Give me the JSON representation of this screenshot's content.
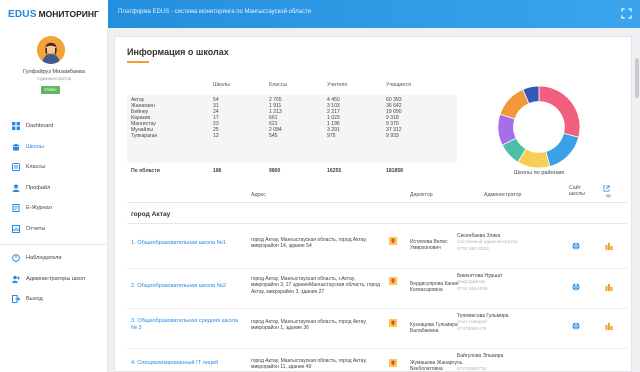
{
  "header": {
    "logo_edus": "EDUS",
    "logo_monitoring": "МОНИТОРИНГ",
    "title": "Платформа EDUS - система мониторинга по Мангыстауской области"
  },
  "user": {
    "name": "Гулфайруз Мизамбаева",
    "role": "Администратор",
    "status": "Online"
  },
  "nav": {
    "main": [
      {
        "label": "Dashboard",
        "icon": "grid-icon"
      },
      {
        "label": "Школы",
        "icon": "school-icon",
        "active": true
      },
      {
        "label": "Классы",
        "icon": "classes-icon"
      },
      {
        "label": "Профайл",
        "icon": "profile-icon"
      },
      {
        "label": "Е-Журнал",
        "icon": "journal-icon"
      },
      {
        "label": "Отчеты",
        "icon": "reports-icon"
      }
    ],
    "secondary": [
      {
        "label": "Наблюдатели",
        "icon": "observer-icon"
      },
      {
        "label": "Администраторы школ",
        "icon": "admin-icon"
      },
      {
        "label": "Выход",
        "icon": "logout-icon"
      }
    ]
  },
  "page": {
    "title": "Информация о школах"
  },
  "stats": {
    "headers": [
      "Школы",
      "Классы",
      "Учителя",
      "Учащиеся"
    ],
    "rows": [
      [
        "Актау",
        "54",
        "2 765",
        "4 450",
        "60 393"
      ],
      [
        "Жанаозен",
        "31",
        "1 911",
        "3 103",
        "36 642"
      ],
      [
        "Бейнеу",
        "24",
        "1 213",
        "2 217",
        "19 090"
      ],
      [
        "Каракия",
        "17",
        "661",
        "1 023",
        "9 318"
      ],
      [
        "Мангистау",
        "23",
        "621",
        "1 196",
        "9 370"
      ],
      [
        "Мунайлы",
        "25",
        "2 084",
        "3 291",
        "37 312"
      ],
      [
        "Тупкараган",
        "12",
        "545",
        "975",
        "9 933"
      ]
    ],
    "total": [
      "По области",
      "186",
      "9800",
      "16255",
      "181858"
    ]
  },
  "chart_data": {
    "type": "pie",
    "title": "",
    "caption": "Школы по районам",
    "categories": [
      "Актау",
      "Жанаозен",
      "Бейнеу",
      "Каракия",
      "Мангистау",
      "Мунайлы",
      "Тупкараган"
    ],
    "values": [
      54,
      31,
      24,
      17,
      23,
      25,
      12
    ],
    "colors": [
      "#f25f7e",
      "#3aa0e8",
      "#f7cf55",
      "#4dbfa8",
      "#a66ee8",
      "#f1993a",
      "#3457b8"
    ],
    "hole": 0.62
  },
  "list": {
    "headers": {
      "address": "Адрес",
      "director": "Директор",
      "admin": "Администратор",
      "site": "Сайт школы"
    },
    "city": "город Актау",
    "schools": [
      {
        "name": "1. Общеобразовательная школа №1",
        "address": "город Актау, Мангыстауская область, город Актау, микрорайон 14, здание 54",
        "director": "Истлеева Велес Умирхонович",
        "admin_name": "Сисенбаева Злика",
        "admin_role": "Системный администратор",
        "admin_phone": "8701 860 8032"
      },
      {
        "name": "2. Общеобразовательная школа №2",
        "address": "город Актау, Мангыстауская область, г.Актау, микрорайон 3, 27 зданиеМангыстауская область, город Актау, микрорайон 3, здание 27",
        "director": "Бердисупрова Кания Колкасаровна",
        "admin_name": "Бикенгтова Нуршат",
        "admin_role": "Информатик",
        "admin_phone": "8701 6614595"
      },
      {
        "name": "3. Общеобразовательная средняя школа № 3",
        "address": "город Актау, Мангыстауская область, город Актау, микрорайон 1, здание 36",
        "director": "Кузнацова Гульмира Балабаевна",
        "admin_name": "Толемисова Гульмира",
        "admin_role": "Учит ковидой",
        "admin_phone": "87478995479"
      },
      {
        "name": "4. Специализированный IT лицей",
        "address": "город Актау, Мангыстауская область, город Актау, микрорайон 11, здание 49",
        "director": "Жумашева Жанаргуль Бекболатовна",
        "admin_name": "Байгулова Эльмира",
        "admin_role": "",
        "admin_phone": "87783560733"
      }
    ]
  }
}
